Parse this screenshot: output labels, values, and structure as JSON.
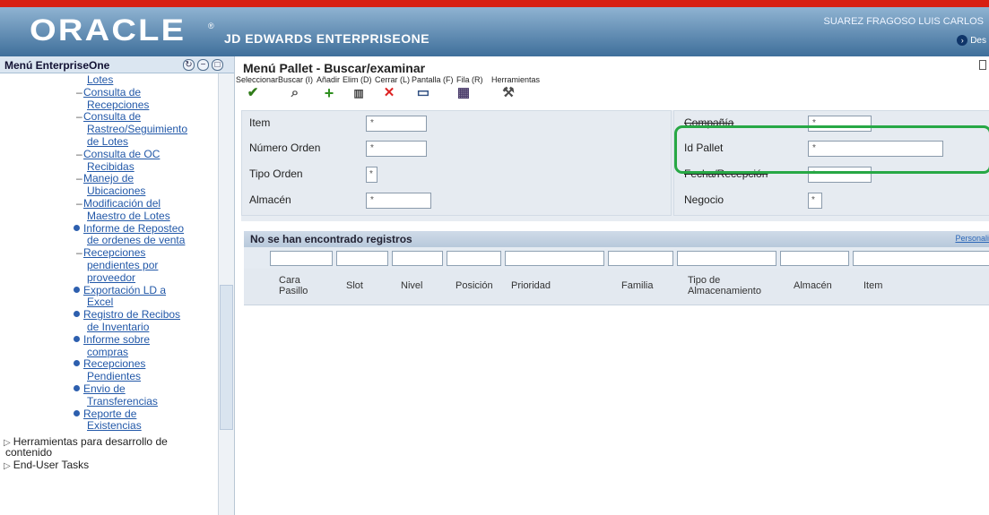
{
  "app": {
    "brand": "ORACLE",
    "product": "JD EDWARDS ENTERPRISEONE",
    "user": "SUAREZ FRAGOSO LUIS CARLOS",
    "logout": "Des",
    "reg": "®"
  },
  "left": {
    "title": "Menú EnterpriseOne",
    "items": [
      {
        "text": "Lotes",
        "kind": "cont"
      },
      {
        "text": "Consulta de",
        "kind": "dash"
      },
      {
        "text": "Recepciones",
        "kind": "cont"
      },
      {
        "text": "Consulta de",
        "kind": "dash"
      },
      {
        "text": "Rastreo/Seguimiento",
        "kind": "cont"
      },
      {
        "text": "de Lotes",
        "kind": "cont"
      },
      {
        "text": "Consulta de OC",
        "kind": "dash"
      },
      {
        "text": "Recibidas",
        "kind": "cont"
      },
      {
        "text": "Manejo de",
        "kind": "dash"
      },
      {
        "text": "Ubicaciones",
        "kind": "cont"
      },
      {
        "text": "Modificación del",
        "kind": "dash"
      },
      {
        "text": "Maestro de Lotes",
        "kind": "cont"
      },
      {
        "text": "Informe de Reposteo",
        "kind": "bullet"
      },
      {
        "text": "de ordenes de venta",
        "kind": "cont"
      },
      {
        "text": "Recepciones",
        "kind": "dash"
      },
      {
        "text": "pendientes por",
        "kind": "cont"
      },
      {
        "text": "proveedor",
        "kind": "cont"
      },
      {
        "text": "Exportación LD a",
        "kind": "bullet"
      },
      {
        "text": "Excel",
        "kind": "cont"
      },
      {
        "text": "Registro de Recibos",
        "kind": "bullet"
      },
      {
        "text": "de Inventario",
        "kind": "cont"
      },
      {
        "text": "Informe sobre",
        "kind": "bullet"
      },
      {
        "text": "compras",
        "kind": "cont"
      },
      {
        "text": "Recepciones",
        "kind": "bullet"
      },
      {
        "text": "Pendientes",
        "kind": "cont"
      },
      {
        "text": "Envio de",
        "kind": "bullet"
      },
      {
        "text": "Transferencias",
        "kind": "cont"
      },
      {
        "text": "Reporte de",
        "kind": "bullet"
      },
      {
        "text": "Existencias",
        "kind": "cont"
      }
    ],
    "extra": [
      "Herramientas para desarrollo de",
      "contenido",
      "End-User Tasks"
    ]
  },
  "main": {
    "title": "Menú Pallet - Buscar/examinar",
    "toolbar": [
      "Seleccionar",
      "Buscar (I)",
      "Añadir",
      "Elim (D)",
      "Cerrar (L)",
      "Pantalla (F)",
      "Fila (R)",
      "Herramientas"
    ],
    "form": {
      "item": "Item",
      "orden": "Número Orden",
      "tipo": "Tipo Orden",
      "almacen": "Almacén",
      "compania": "Compañía",
      "pallet": "Id Pallet",
      "fecha": "Fecha/Recepción",
      "negocio": "Negocio",
      "star": "*"
    },
    "grid": {
      "message": "No se han encontrado registros",
      "personal": "Personali",
      "columns": [
        "Cara Pasillo",
        "Slot",
        "Nivel",
        "Posición",
        "Prioridad",
        "Familia",
        "Tipo de Almacenamiento",
        "Almacén",
        "Item"
      ]
    }
  }
}
